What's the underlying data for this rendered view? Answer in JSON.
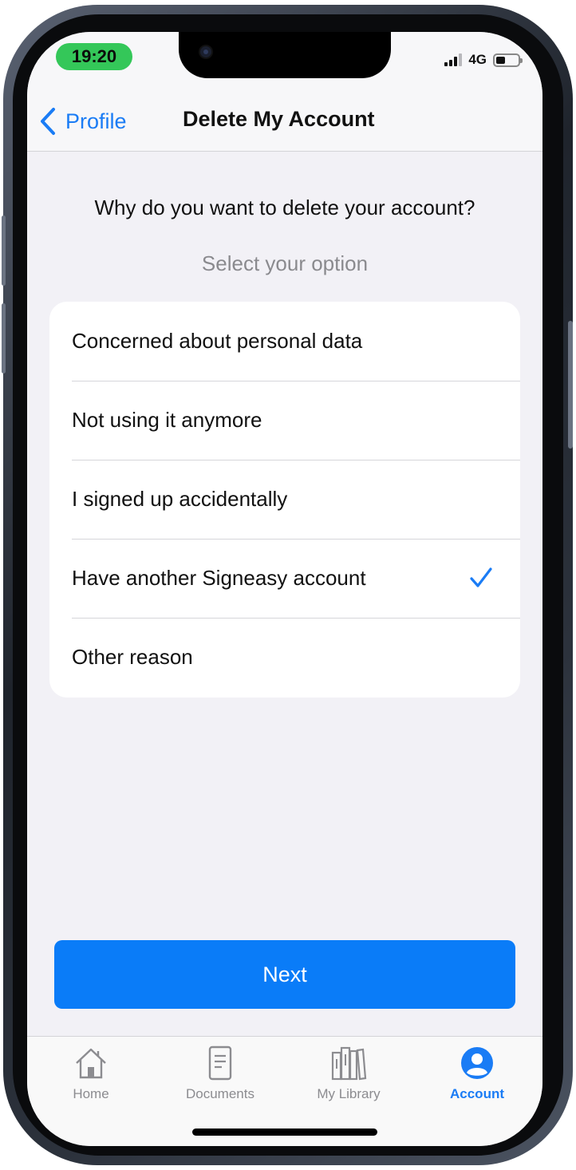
{
  "status_bar": {
    "time": "19:20",
    "network": "4G"
  },
  "nav": {
    "back_label": "Profile",
    "title": "Delete My Account"
  },
  "main": {
    "question": "Why do you want to delete your account?",
    "hint": "Select your option",
    "options": [
      {
        "label": "Concerned about personal data",
        "selected": false
      },
      {
        "label": "Not using it anymore",
        "selected": false
      },
      {
        "label": "I signed up accidentally",
        "selected": false
      },
      {
        "label": "Have another Signeasy account",
        "selected": true
      },
      {
        "label": "Other reason",
        "selected": false
      }
    ],
    "next_label": "Next"
  },
  "tabbar": {
    "tabs": [
      {
        "label": "Home",
        "icon": "house-icon",
        "active": false
      },
      {
        "label": "Documents",
        "icon": "document-icon",
        "active": false
      },
      {
        "label": "My Library",
        "icon": "library-icon",
        "active": false
      },
      {
        "label": "Account",
        "icon": "account-icon",
        "active": true
      }
    ]
  },
  "colors": {
    "accent": "#1a7cf5",
    "button": "#0a7cf8",
    "time_pill": "#34c759",
    "background": "#f2f1f6"
  }
}
